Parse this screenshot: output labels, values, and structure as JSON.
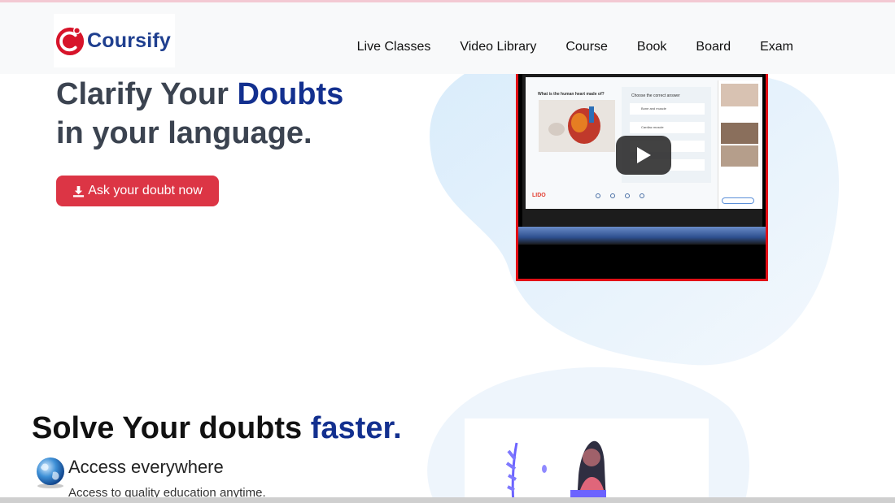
{
  "header": {
    "logo_text": "Coursify",
    "nav": [
      "Live Classes",
      "Video Library",
      "Course",
      "Book",
      "Board",
      "Exam"
    ]
  },
  "hero": {
    "title_part1": "Clarify Your ",
    "title_highlight": "Doubts",
    "title_line2": "in your language.",
    "cta_label": "Ask your doubt now"
  },
  "video": {
    "question": "What is the human heart made of?",
    "answer_header": "Choose the correct answer",
    "options": [
      "Bone and muscle",
      "Cardiac muscle",
      "",
      ""
    ],
    "brand": "LIDO"
  },
  "section2": {
    "title_part1": "Solve Your doubts ",
    "title_highlight": "faster.",
    "feature_title": "Access everywhere",
    "feature_desc": "Access to quality education anytime."
  },
  "colors": {
    "accent_blue": "#13308f",
    "cta_red": "#dc3545",
    "video_border": "#e30e16"
  }
}
